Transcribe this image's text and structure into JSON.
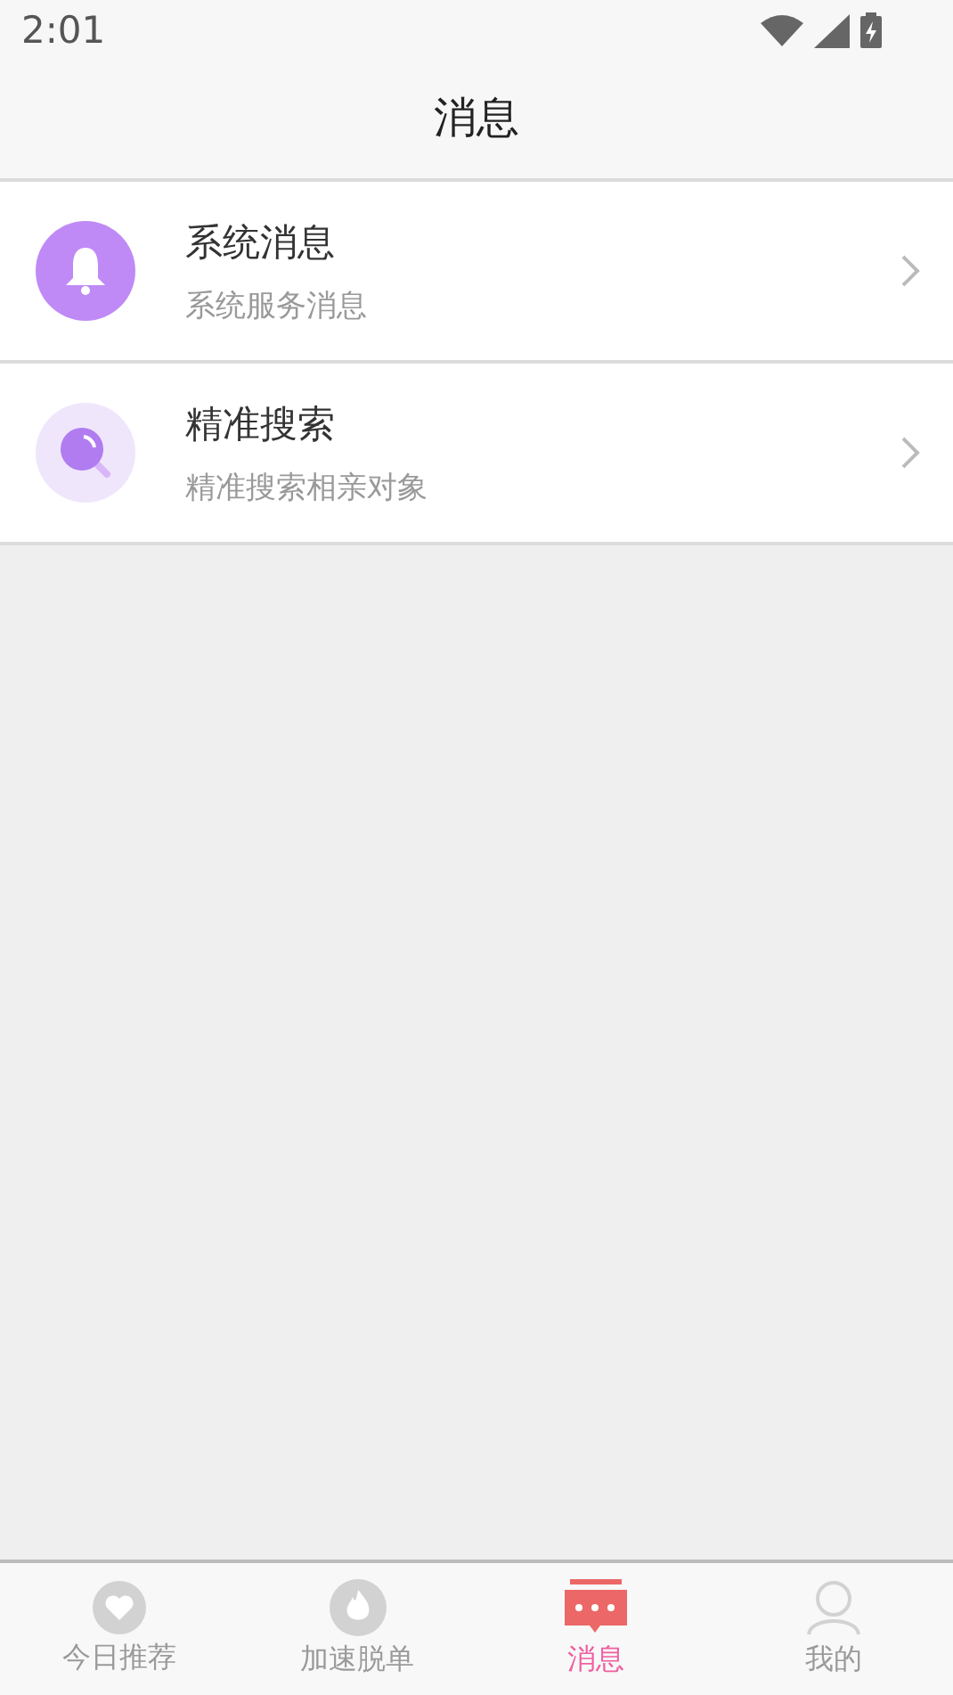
{
  "status_bar": {
    "time": "2:01"
  },
  "header": {
    "title": "消息"
  },
  "messages": [
    {
      "kind": "bell",
      "title": "系统消息",
      "subtitle": "系统服务消息"
    },
    {
      "kind": "search",
      "title": "精准搜索",
      "subtitle": "精准搜索相亲对象"
    }
  ],
  "tabs": [
    {
      "kind": "heart",
      "label": "今日推荐",
      "selected": false
    },
    {
      "kind": "flame",
      "label": "加速脱单",
      "selected": false
    },
    {
      "kind": "chat",
      "label": "消息",
      "selected": true
    },
    {
      "kind": "person",
      "label": "我的",
      "selected": false
    }
  ]
}
